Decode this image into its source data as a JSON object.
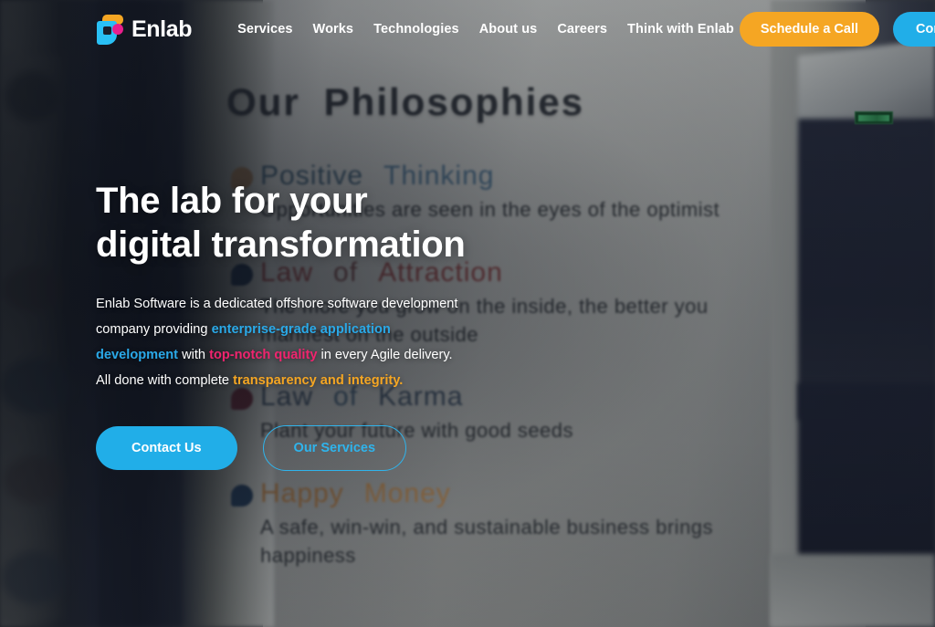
{
  "header": {
    "brand": {
      "name": "Enlab",
      "logo_icon": "enlab-logo-icon"
    },
    "nav": [
      {
        "label": "Services"
      },
      {
        "label": "Works"
      },
      {
        "label": "Technologies"
      },
      {
        "label": "About us"
      },
      {
        "label": "Careers"
      },
      {
        "label": "Think with Enlab"
      }
    ],
    "schedule_label": "Schedule a Call",
    "contact_label": "Contact Us",
    "schedule_color": "#f5a623",
    "contact_color": "#21aee8"
  },
  "hero": {
    "heading_line1": "The lab for your",
    "heading_line2": "digital transformation",
    "paragraph": {
      "p1": "Enlab Software is a dedicated offshore software development company providing ",
      "link1": "enterprise-grade application development",
      "p2": " with ",
      "link2": "top-notch quality",
      "p3": " in every Agile delivery. All done with complete ",
      "link3": "transparency and integrity."
    },
    "link1_color": "#2aa9e8",
    "link2_color": "#f0246e",
    "link3_color": "#f5a623",
    "cta_primary": "Contact Us",
    "cta_secondary": "Our Services"
  },
  "background_wall": {
    "title_word1": "Our",
    "title_word2": "Philosophies",
    "items": [
      {
        "dot_color": "#8a6a4a",
        "head_word1": "Positive",
        "head_word2": "Thinking",
        "head_color1": "#3d5a6e",
        "head_color2": "#4a6e8a",
        "body": "Opportunities  are  seen  in  the  eyes  of  the  optimist"
      },
      {
        "dot_color": "#1e2f47",
        "head_word1": "Law",
        "head_word2": "of",
        "head_word3": "Attraction",
        "head_color1": "#8a4040",
        "head_color2": "#6e4545",
        "body": "The more  you  grow  on  the  inside,  the  better  you manifest  on  the  outside"
      },
      {
        "dot_color": "#5c2430",
        "head_word1": "Law",
        "head_word2": "of",
        "head_word3": "Karma",
        "head_color1": "#3a4a5c",
        "head_color2": "#3d566b",
        "body": "Plant  your  future  with  good  seeds"
      },
      {
        "dot_color": "#1e3550",
        "head_word1": "Happy",
        "head_word2": "Money",
        "head_color1": "#b07a42",
        "head_color2": "#c08a4e",
        "body": "A safe, win-win, and sustainable business  brings happiness"
      }
    ]
  }
}
